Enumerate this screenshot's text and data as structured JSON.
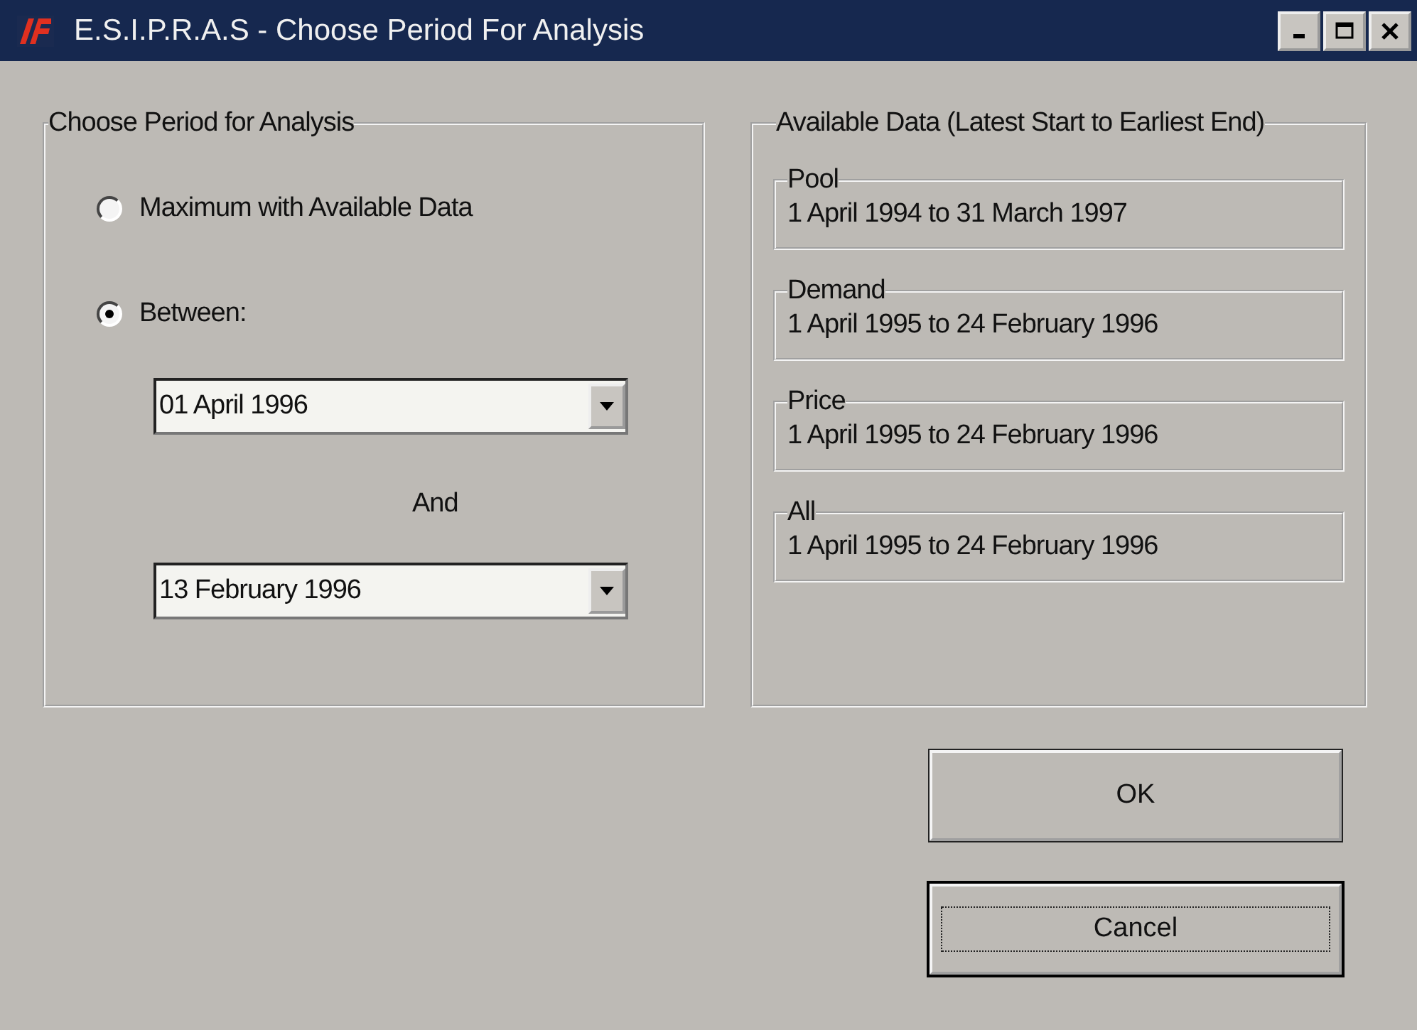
{
  "window": {
    "title": "E.S.I.P.R.A.S - Choose Period For Analysis"
  },
  "period_group": {
    "title": "Choose Period for Analysis",
    "options": [
      {
        "label": "Maximum with Available Data",
        "selected": false
      },
      {
        "label": "Between:",
        "selected": true
      }
    ],
    "start_date": {
      "value": "01 April 1996"
    },
    "connector": "And",
    "end_date": {
      "value": "13 February 1996"
    }
  },
  "available_group": {
    "title": "Available Data (Latest Start to Earliest End)",
    "datasets": [
      {
        "name": "Pool",
        "range": "1 April 1994 to 31 March 1997"
      },
      {
        "name": "Demand",
        "range": "1 April 1995 to 24 February 1996"
      },
      {
        "name": "Price",
        "range": "1 April 1995 to 24 February 1996"
      },
      {
        "name": "All",
        "range": "1 April 1995 to 24 February 1996"
      }
    ]
  },
  "buttons": [
    {
      "label": "OK",
      "focused": false
    },
    {
      "label": "Cancel",
      "focused": true
    }
  ]
}
